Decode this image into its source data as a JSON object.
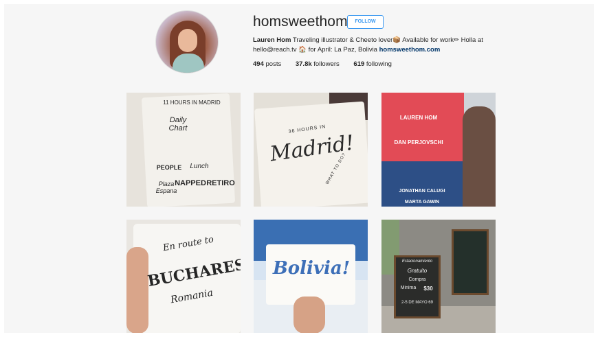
{
  "profile": {
    "username": "homsweethom",
    "follow_label": "FOLLOW",
    "bio": {
      "name": "Lauren Hom",
      "line1": " Traveling illustrator & Cheeto lover",
      "line1b": " Available for work",
      "line1c": " Holla at",
      "line2a": "hello@reach.tv ",
      "line2b": " for April: La Paz, Bolivia ",
      "link": "homsweethom.com"
    },
    "stats": [
      {
        "count": "494",
        "label": " posts"
      },
      {
        "count": "37.8k",
        "label": " followers"
      },
      {
        "count": "619",
        "label": " following"
      }
    ]
  },
  "posts": [
    {
      "name": "madrid-sketchbook-post",
      "lettering": [
        "11 HOURS IN MADRID",
        "Daily Chart",
        "PEOPLE",
        "NAPPED",
        "RETIRO",
        "Lunch",
        "Plaza Espana"
      ]
    },
    {
      "name": "madrid-lettering-post",
      "lettering": [
        "36 HOURS IN",
        "Madrid!",
        "WHAT TO DO?"
      ]
    },
    {
      "name": "event-poster-post",
      "lettering": [
        "LAUREN HOM",
        "DAN PERJOVSCHI",
        "JONATHAN CALUGI",
        "MARTA GAWIN"
      ]
    },
    {
      "name": "bucharest-lettering-post",
      "lettering": [
        "En route to",
        "BUCHAREST",
        "Romania"
      ]
    },
    {
      "name": "bolivia-lettering-post",
      "lettering": [
        "Bolivia!"
      ]
    },
    {
      "name": "chalkboard-signs-post",
      "lettering": [
        "Estacionamiento",
        "Gratuito",
        "Compra",
        "Minima",
        "$30",
        "2-5 DE MAYO 69"
      ]
    }
  ]
}
